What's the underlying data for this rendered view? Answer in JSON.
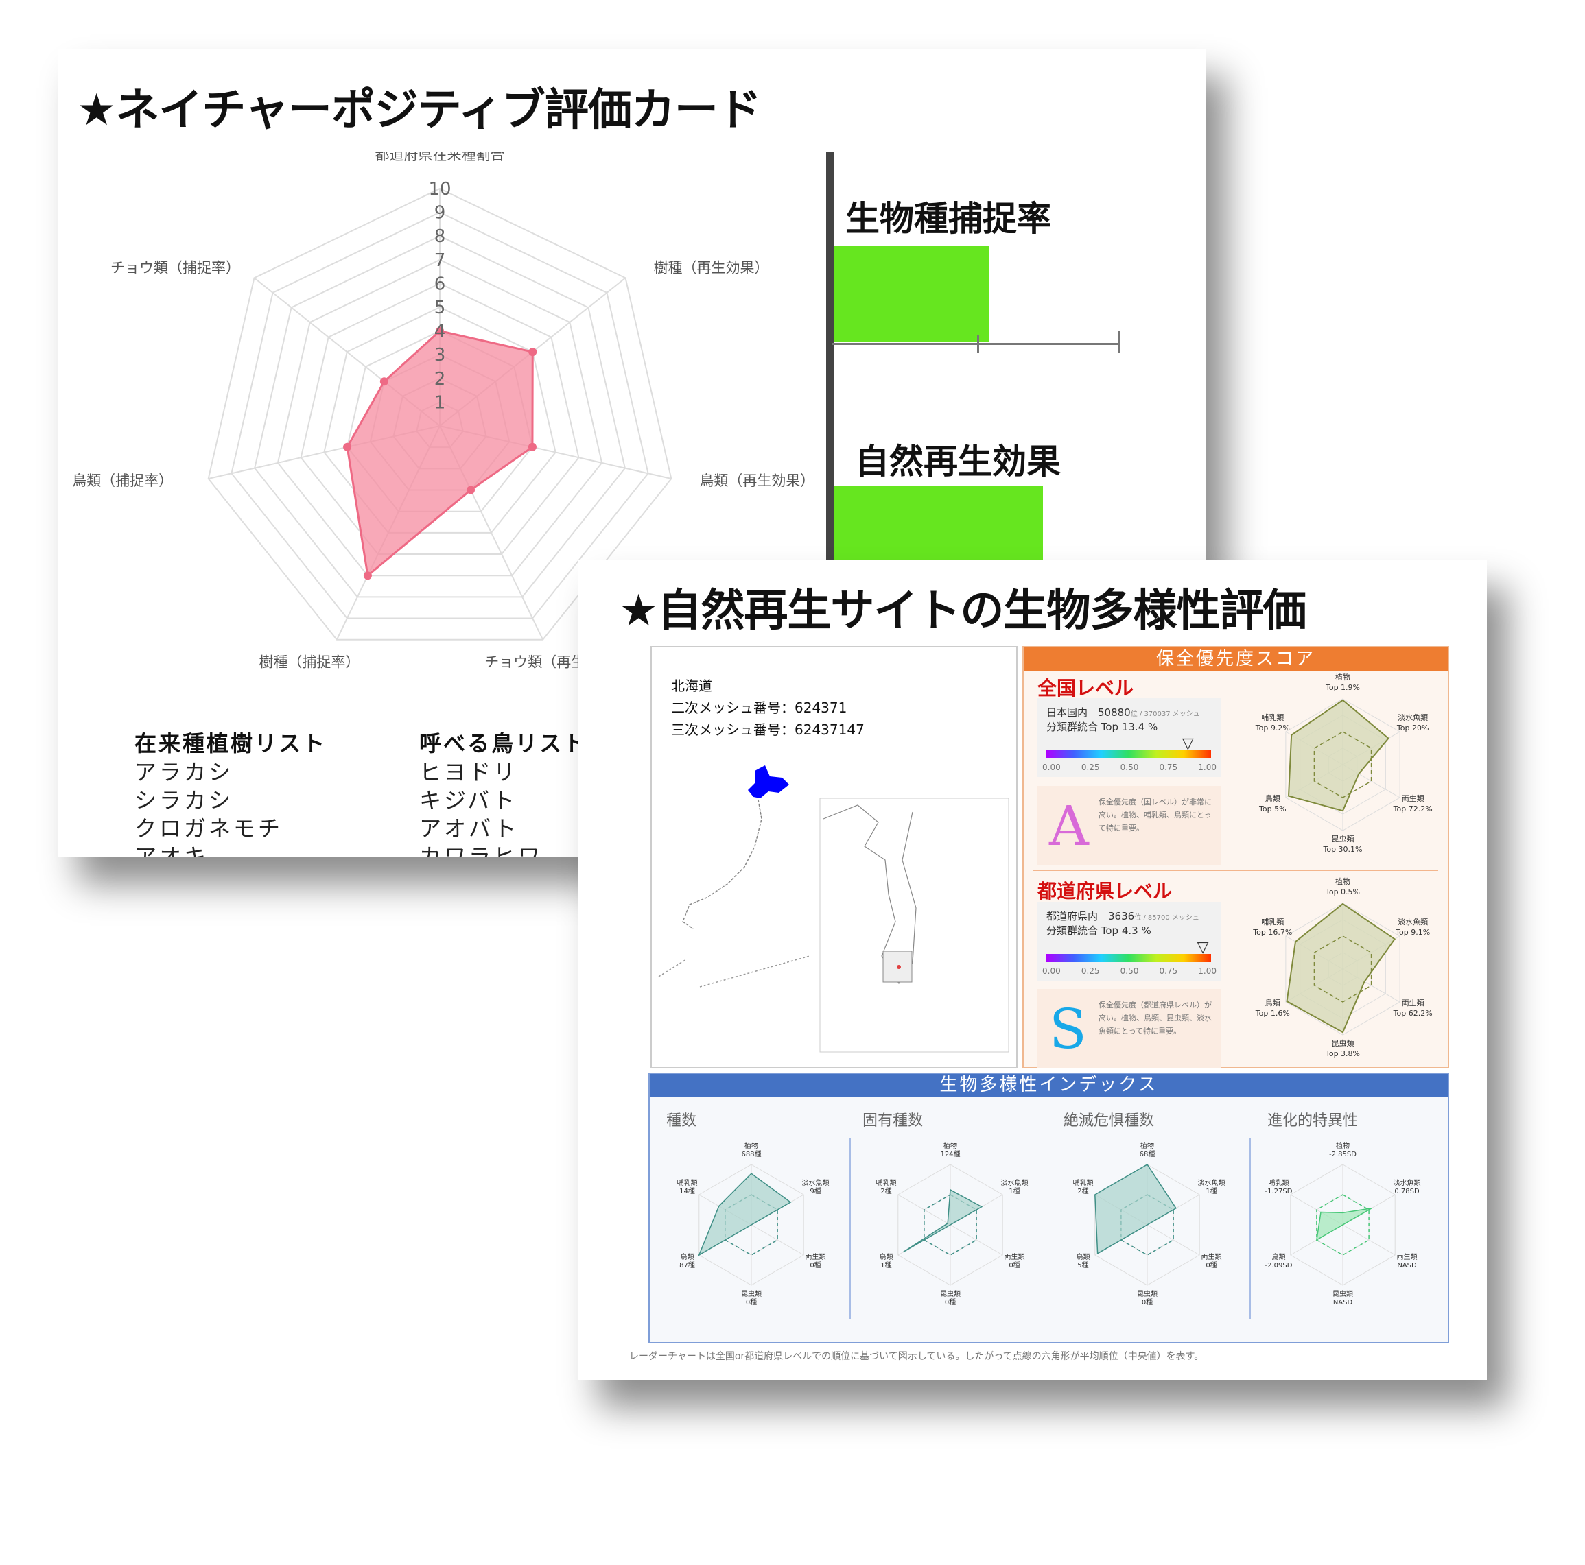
{
  "card1": {
    "title": "★ネイチャーポジティブ評価カード",
    "radar": {
      "axes": [
        "都道府県在来種割合",
        "樹種（再生効果）",
        "鳥類（再生効果）",
        "チョウ類（再生効果）",
        "樹種（捕捉率）",
        "鳥類（捕捉率）",
        "チョウ類（捕捉率）"
      ],
      "values": [
        4,
        5,
        4,
        3,
        7,
        4,
        3
      ],
      "ticks": [
        "1",
        "2",
        "3",
        "4",
        "5",
        "6",
        "7",
        "8",
        "9",
        "10"
      ],
      "max": 10,
      "fill": "#f58ca0",
      "stroke": "#ee6a85"
    },
    "bars": [
      {
        "title": "生物種捕捉率",
        "value": 0.54
      },
      {
        "title": "自然再生効果",
        "value": 0.73
      }
    ],
    "bar_color": "#66e61f",
    "lists": [
      {
        "heading": "在来種植樹リスト",
        "items": [
          "アラカシ",
          "シラカシ",
          "クロガネモチ",
          "アオキ"
        ]
      },
      {
        "heading": "呼べる鳥リスト",
        "items": [
          "ヒヨドリ",
          "キジバト",
          "アオバト",
          "カワラヒワ"
        ]
      }
    ]
  },
  "card2": {
    "title": "★自然再生サイトの生物多様性評価",
    "map": {
      "prefecture": "北海道",
      "mesh2": "二次メッシュ番号：624371",
      "mesh3": "三次メッシュ番号：62437147",
      "highlight_color": "#0000ff"
    },
    "score": {
      "header": "保全優先度スコア",
      "header_color": "#ee7d31",
      "ticks": [
        "0.00",
        "0.25",
        "0.50",
        "0.75",
        "1.00"
      ],
      "levels": [
        {
          "title": "全国レベル",
          "line1": "日本国内　50880",
          "line1_small": "位 / 370037 メッシュ",
          "line2": "分類群統合 Top 13.4 %",
          "marker": 0.866,
          "grade": "A",
          "grade_color": "#d86ad8",
          "grade_text": "保全優先度（国レベル）が非常に高い。植物、哺乳類、鳥類にとって特に重要。",
          "radar": [
            {
              "name": "植物",
              "top": "Top 1.9%",
              "r": 0.98
            },
            {
              "name": "淡水魚類",
              "top": "Top 20%",
              "r": 0.8
            },
            {
              "name": "両生類",
              "top": "Top 72.2%",
              "r": 0.28
            },
            {
              "name": "昆虫類",
              "top": "Top 30.1%",
              "r": 0.7
            },
            {
              "name": "鳥類",
              "top": "Top 5%",
              "r": 0.95
            },
            {
              "name": "哺乳類",
              "top": "Top 9.2%",
              "r": 0.9
            }
          ]
        },
        {
          "title": "都道府県レベル",
          "line1": "都道府県内　3636",
          "line1_small": "位 / 85700 メッシュ",
          "line2": "分類群統合 Top 4.3 %",
          "marker": 0.957,
          "grade": "S",
          "grade_color": "#18a8e8",
          "grade_text": "保全優先度（都道府県レベル）が高い。植物、鳥類、昆虫類、淡水魚類にとって特に重要。",
          "radar": [
            {
              "name": "植物",
              "top": "Top 0.5%",
              "r": 0.99
            },
            {
              "name": "淡水魚類",
              "top": "Top 9.1%",
              "r": 0.91
            },
            {
              "name": "両生類",
              "top": "Top 62.2%",
              "r": 0.38
            },
            {
              "name": "昆虫類",
              "top": "Top 3.8%",
              "r": 0.96
            },
            {
              "name": "鳥類",
              "top": "Top 1.6%",
              "r": 0.98
            },
            {
              "name": "哺乳類",
              "top": "Top 16.7%",
              "r": 0.83
            }
          ]
        }
      ]
    },
    "index": {
      "header": "生物多様性インデックス",
      "header_color": "#4472c4",
      "charts": [
        {
          "title": "種数",
          "fill": "#a9d3cc",
          "stroke": "#3f8f86",
          "labels": [
            "植物\n688種",
            "淡水魚類\n9種",
            "両生類\n0種",
            "昆虫類\n0種",
            "鳥類\n87種",
            "哺乳類\n14種"
          ],
          "values": [
            0.85,
            0.75,
            0,
            0,
            1.0,
            0.62
          ]
        },
        {
          "title": "固有種数",
          "fill": "#a9d3cc",
          "stroke": "#3f8f86",
          "labels": [
            "植物\n124種",
            "淡水魚類\n1種",
            "両生類\n0種",
            "昆虫類\n0種",
            "鳥類\n1種",
            "哺乳類\n2種"
          ],
          "values": [
            0.58,
            0.6,
            0,
            0,
            0.9,
            0.05
          ]
        },
        {
          "title": "絶滅危惧種数",
          "fill": "#a9d3cc",
          "stroke": "#3f8f86",
          "labels": [
            "植物\n68種",
            "淡水魚類\n1種",
            "両生類\n0種",
            "昆虫類\n0種",
            "鳥類\n5種",
            "哺乳類\n2種"
          ],
          "values": [
            1.0,
            0.55,
            0,
            0,
            0.95,
            1.0
          ]
        },
        {
          "title": "進化的特異性",
          "fill": "#9fe7b6",
          "stroke": "#47c777",
          "labels": [
            "植物\n-2.85SD",
            "淡水魚類\n0.78SD",
            "両生類\nNASD",
            "昆虫類\nNASD",
            "鳥類\n-2.09SD",
            "哺乳類\n-1.27SD"
          ],
          "values": [
            0.2,
            0.55,
            0,
            0,
            0.5,
            0.42
          ]
        }
      ]
    },
    "footnote": "レーダーチャートは全国or都道府県レベルでの順位に基づいて図示している。したがって点線の六角形が平均順位（中央値）を表す。"
  }
}
